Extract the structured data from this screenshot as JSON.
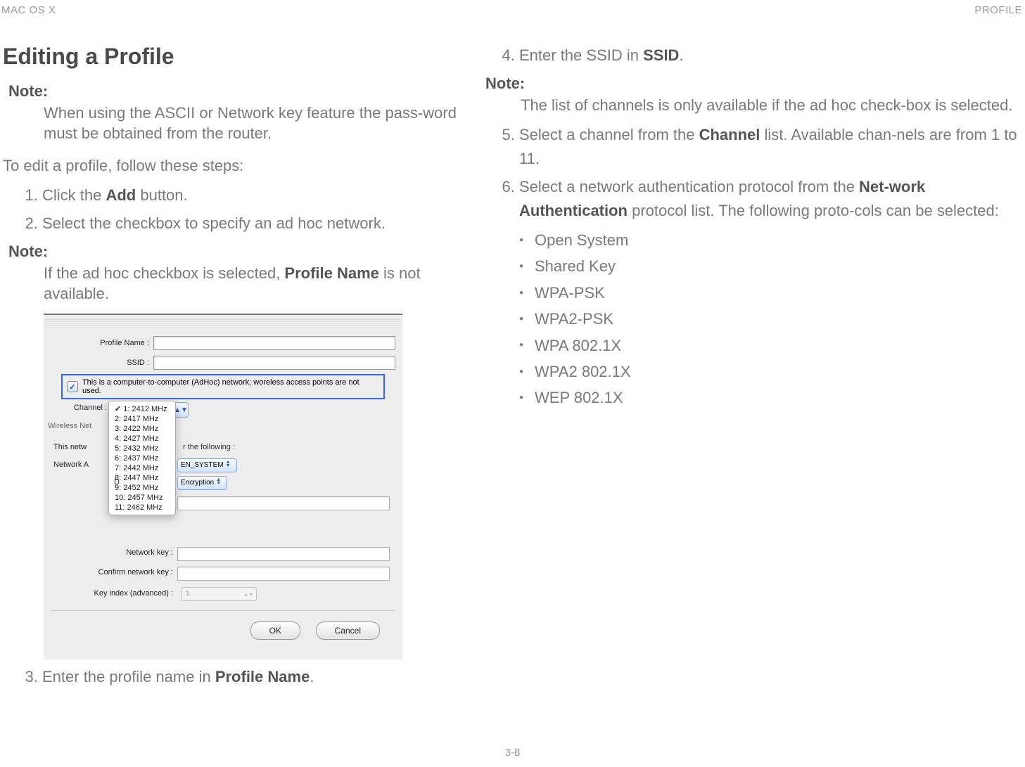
{
  "header": {
    "left": "MAC OS X",
    "right": "PROFILE"
  },
  "title": "Editing a Profile",
  "note1": {
    "label": "Note:",
    "body": "When using the ASCII or Network key feature the pass-word must be obtained from the router."
  },
  "intro": "To edit a profile, follow these steps:",
  "step1_pre": "Click the ",
  "step1_bold": "Add",
  "step1_post": " button.",
  "step2": "Select the checkbox to specify an ad hoc network.",
  "note2": {
    "label": "Note:",
    "body_pre": "If the ad hoc checkbox is selected, ",
    "body_bold": "Profile Name",
    "body_post": " is not available."
  },
  "step3_pre": "Enter the profile name in ",
  "step3_bold": "Profile Name",
  "step3_post": ".",
  "step4_pre": "Enter the SSID in ",
  "step4_bold": "SSID",
  "step4_post": ".",
  "note3": {
    "label": "Note:",
    "body": "The list of channels is only available if the ad hoc check-box is selected."
  },
  "step5_pre": "Select a channel from the ",
  "step5_bold": "Channel",
  "step5_post": " list. Available chan-nels are from 1 to 11.",
  "step6_pre": "Select a network authentication protocol from the ",
  "step6_bold": "Net-work Authentication",
  "step6_post": " protocol list. The following proto-cols can be selected:",
  "protocols": [
    "Open System",
    "Shared Key",
    "WPA-PSK",
    "WPA2-PSK",
    "WPA 802.1X",
    "WPA2 802.1X",
    "WEP 802.1X"
  ],
  "page_number": "3-8",
  "dialog": {
    "profile_name_label": "Profile Name :",
    "ssid_label": "SSID :",
    "adhoc_check": "✓",
    "adhoc_text": "This is a computer-to-computer (AdHoc) network; woreless access points are not used.",
    "channel_label": "Channel :",
    "channel_options": [
      "1: 2412 MHz",
      "2: 2417 MHz",
      "3: 2422 MHz",
      "4: 2427 MHz",
      "5: 2432 MHz",
      "6: 2437 MHz",
      "7: 2442 MHz",
      "8: 2447 MHz",
      "9: 2452 MHz",
      "10: 2457 MHz",
      "11: 2462 MHz"
    ],
    "wireless_label": "Wireless Net",
    "security_label_left": "This netw",
    "security_label_right": "r the following :",
    "nauth_label": "Network A",
    "nauth_value": "EN_SYSTEM",
    "denc_label": "D",
    "denc_value": "Encryption",
    "nk_label": "Network key :",
    "cnk_label": "Confirm network key :",
    "kidx_label": "Key index (advanced) :",
    "kidx_value": "1",
    "ok": "OK",
    "cancel": "Cancel"
  }
}
